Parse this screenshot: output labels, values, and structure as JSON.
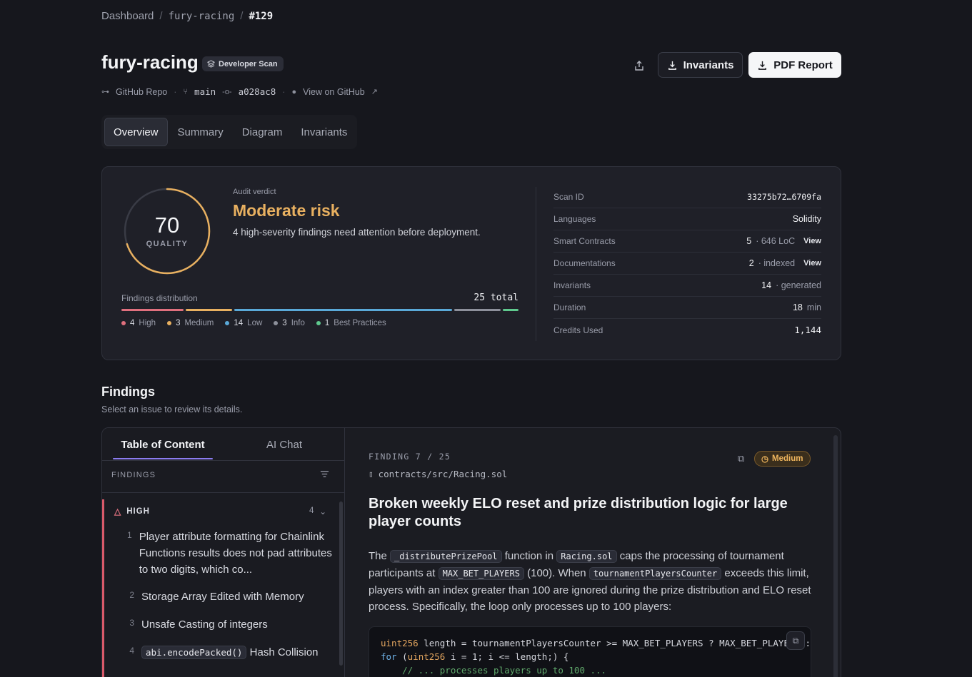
{
  "breadcrumb": {
    "home": "Dashboard",
    "repo": "fury-racing",
    "current": "#129"
  },
  "header": {
    "title": "fury-racing",
    "scan_badge": "Developer Scan",
    "source": "GitHub Repo",
    "branch": "main",
    "commit": "a028ac8",
    "github_link": "View on GitHub",
    "invariants_button": "Invariants",
    "pdf_button": "PDF Report"
  },
  "tabs": [
    "Overview",
    "Summary",
    "Diagram",
    "Invariants"
  ],
  "overview": {
    "score": "70",
    "score_label": "QUALITY",
    "score_value": 70,
    "score_max": 100,
    "verdict_label": "Audit verdict",
    "verdict": "Moderate risk",
    "verdict_desc": "4 high-severity findings need attention before deployment.",
    "dist_label": "Findings distribution",
    "dist_total": "25 total",
    "distribution": [
      {
        "count": "4",
        "label": "High",
        "value": 4,
        "color": "#e0707e"
      },
      {
        "count": "3",
        "label": "Medium",
        "value": 3,
        "color": "#e8b060"
      },
      {
        "count": "14",
        "label": "Low",
        "value": 14,
        "color": "#5aa9d8"
      },
      {
        "count": "3",
        "label": "Info",
        "value": 3,
        "color": "#8d909b"
      },
      {
        "count": "1",
        "label": "Best Practices",
        "value": 1,
        "color": "#5fc98e"
      }
    ],
    "stats": [
      {
        "label": "Scan ID",
        "value": "33275b72…6709fa"
      },
      {
        "label": "Languages",
        "value": "Solidity"
      },
      {
        "label": "Smart Contracts",
        "value": "5",
        "sub": "· 646 LoC",
        "link": "View"
      },
      {
        "label": "Documentations",
        "value": "2",
        "sub": "· indexed",
        "link": "View"
      },
      {
        "label": "Invariants",
        "value": "14",
        "sub": "· generated"
      },
      {
        "label": "Duration",
        "value": "18",
        "sub": "min"
      },
      {
        "label": "Credits Used",
        "value": "1,144"
      }
    ]
  },
  "findings": {
    "heading": "Findings",
    "subheading": "Select an issue to review its details.",
    "tab_toc": "Table of Content",
    "tab_chat": "AI Chat",
    "list_header": "FINDINGS",
    "group": "HIGH",
    "group_count": "4",
    "items": [
      {
        "num": "1",
        "text": "Player attribute formatting for Chainlink Functions results does not pad attributes to two digits, which co..."
      },
      {
        "num": "2",
        "text": "Storage Array Edited with Memory"
      },
      {
        "num": "3",
        "text": "Unsafe Casting of integers"
      },
      {
        "num": "4",
        "code": "abi.encodePacked()",
        "text": "Hash Collision"
      }
    ],
    "detail": {
      "counter": "FINDING 7 / 25",
      "path": "contracts/src/Racing.sol",
      "severity": "Medium",
      "title": "Broken weekly ELO reset and prize distribution logic for large player counts",
      "p1": "The",
      "c1": "_distributePrizePool",
      "p2": "function in",
      "c2": "Racing.sol",
      "p3": "caps the processing of tournament participants at",
      "c3": "MAX_BET_PLAYERS",
      "p4": "(100). When",
      "c4": "tournamentPlayersCounter",
      "p5": "exceeds this limit, players with an index greater than 100 are ignored during the prize distribution and ELO reset process. Specifically, the loop only processes up to 100 players:",
      "code_l1_kw": "uint256",
      "code_l1": " length = tournamentPlayersCounter >= MAX_BET_PLAYERS ? MAX_BET_PLAYERS : tou",
      "code_l2_kw": "for",
      "code_l2a": " (",
      "code_l2_kw2": "uint256",
      "code_l2b": " i = 1; i <= length;) {",
      "code_l3": "    // ... processes players up to 100 ..."
    }
  }
}
